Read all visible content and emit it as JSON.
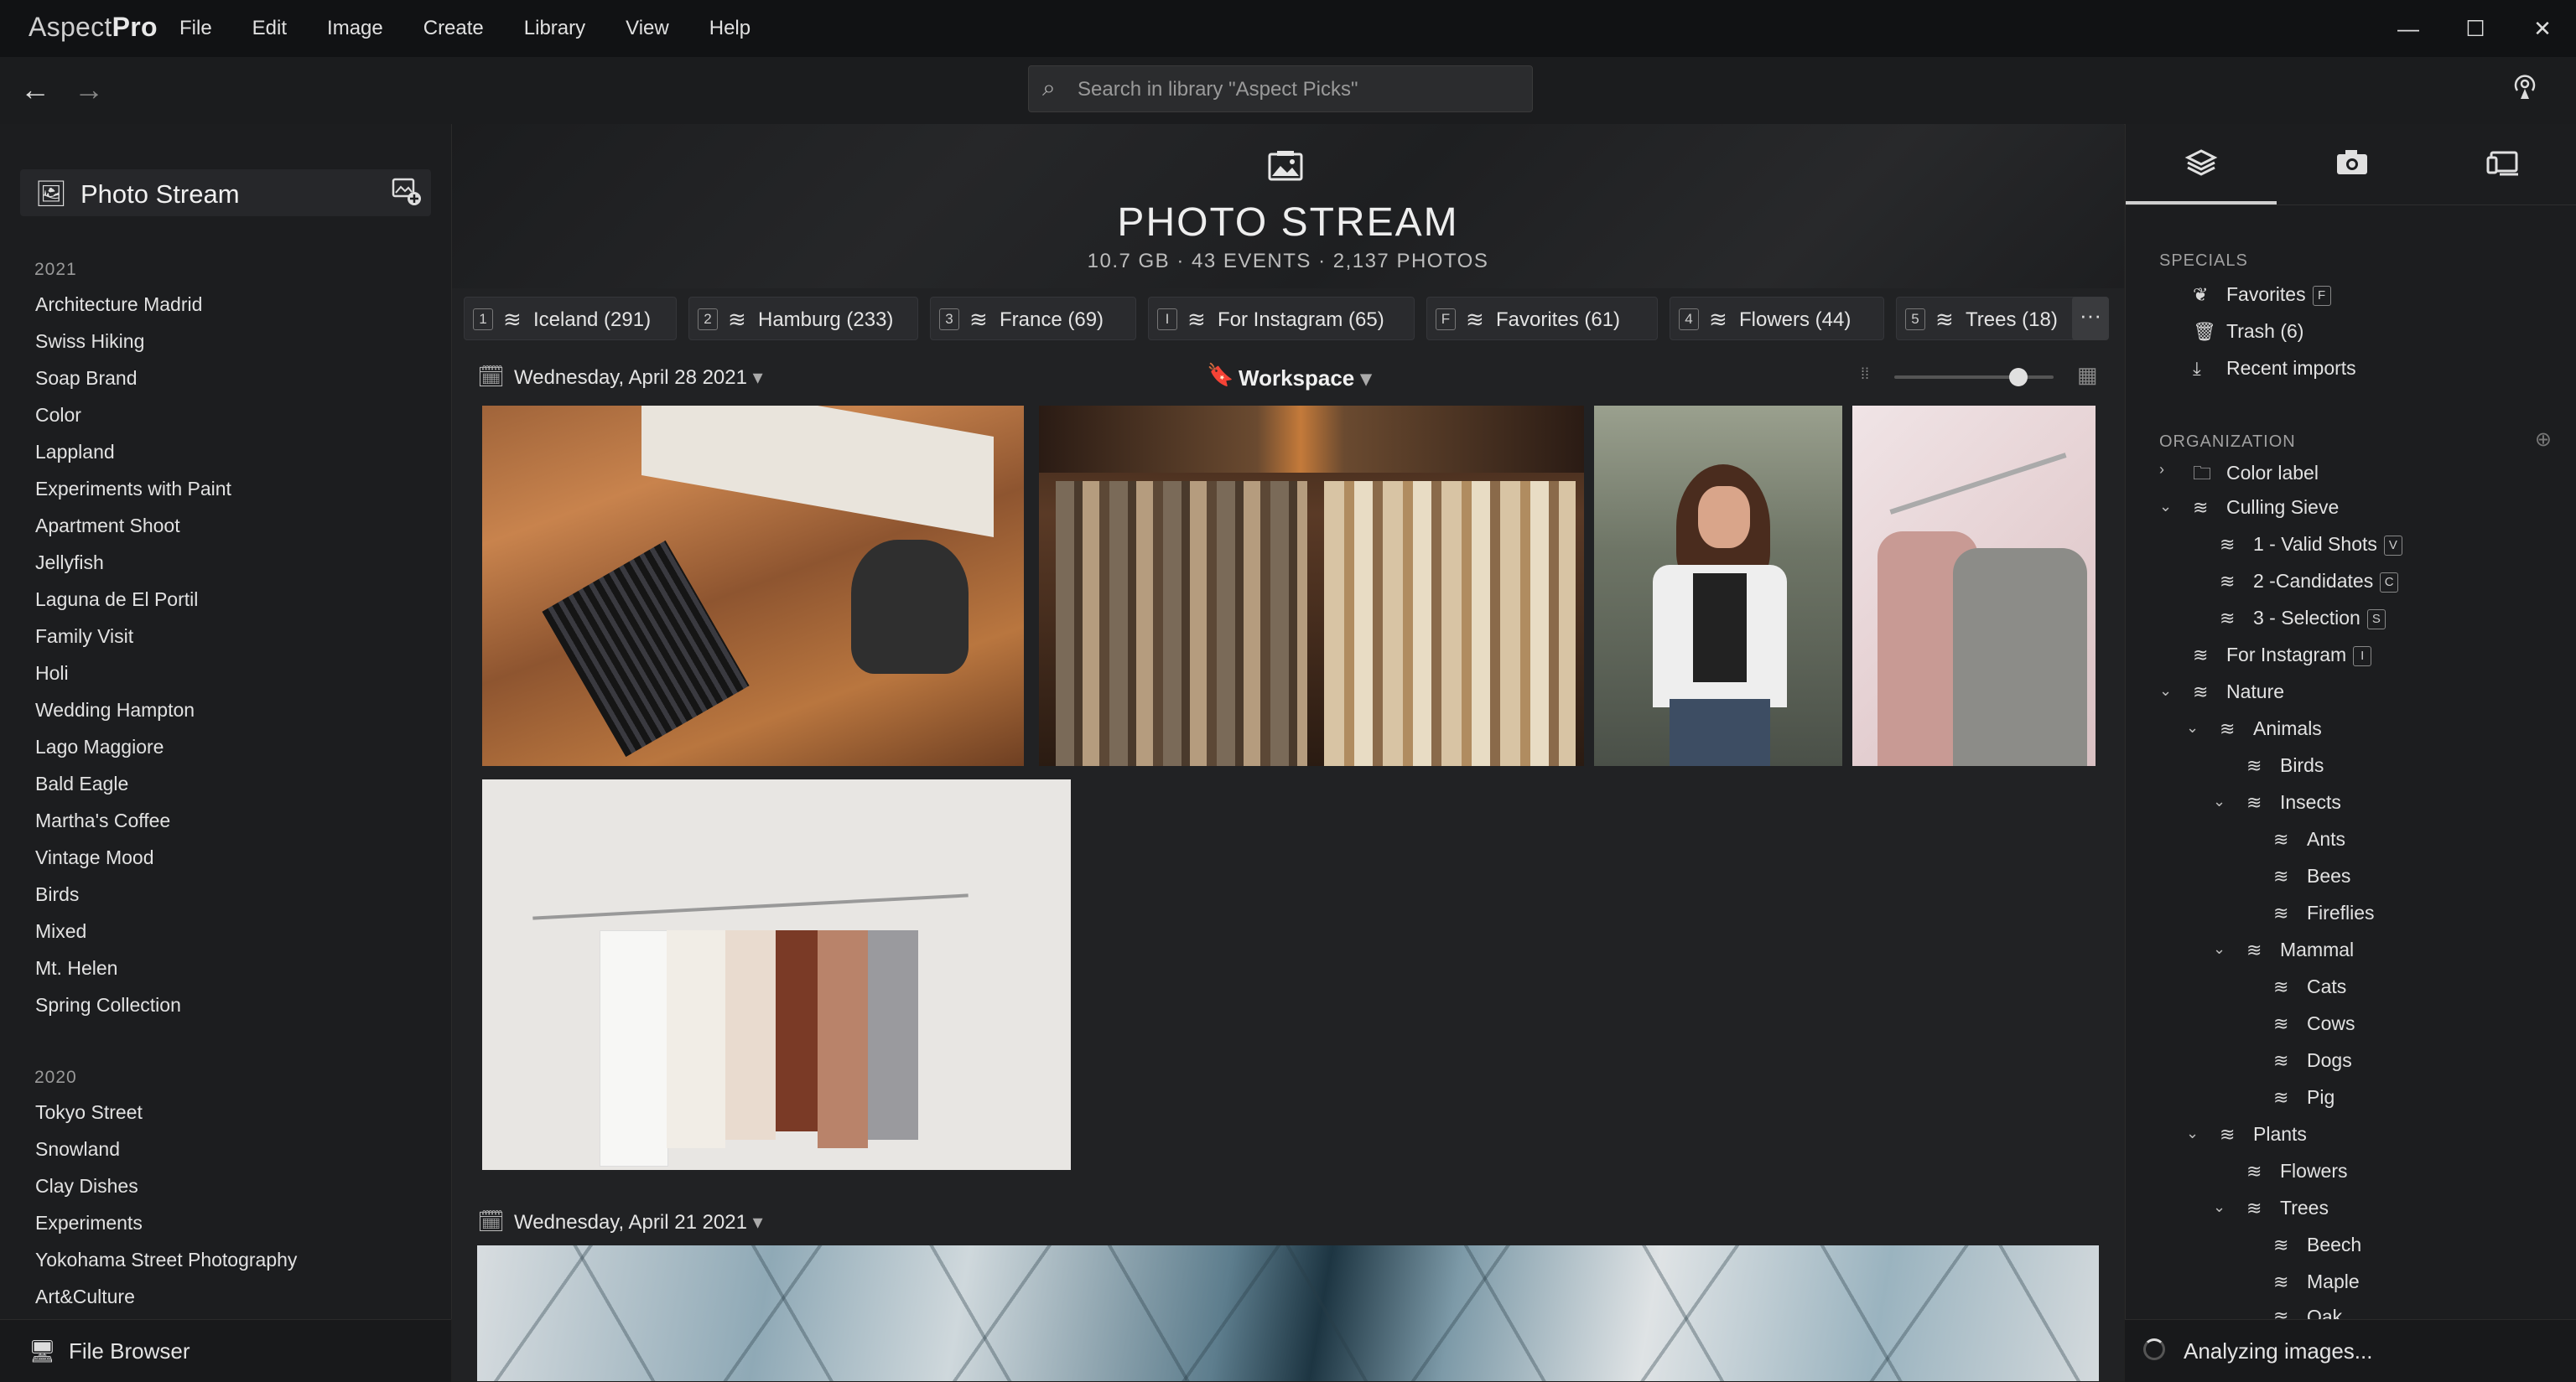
{
  "app": {
    "brand_light": "Aspect",
    "brand_bold": "Pro",
    "menu": [
      "File",
      "Edit",
      "Image",
      "Create",
      "Library",
      "View",
      "Help"
    ],
    "window_controls": [
      "—",
      "☐",
      "✕"
    ]
  },
  "toolbar": {
    "back": "←",
    "forward": "→",
    "search_placeholder": "Search in library \"Aspect Picks\"",
    "search_icon": "search-icon"
  },
  "sidebar": {
    "header_label": "Photo Stream",
    "groups": [
      {
        "year": "2021",
        "items": [
          "Architecture Madrid",
          "Swiss Hiking",
          "Soap Brand",
          "Color",
          "Lappland",
          "Experiments with Paint",
          "Apartment Shoot",
          "Jellyfish",
          "Laguna de El Portil",
          "Family Visit",
          "Holi",
          "Wedding Hampton",
          "Lago Maggiore",
          "Bald Eagle",
          "Martha's Coffee",
          "Vintage Mood",
          "Birds",
          "Mixed",
          "Mt. Helen",
          "Spring Collection"
        ]
      },
      {
        "year": "2020",
        "items": [
          "Tokyo Street",
          "Snowland",
          "Clay Dishes",
          "Experiments",
          "Yokohama Street Photography",
          "Art&Culture"
        ]
      }
    ],
    "footer_label": "File Browser"
  },
  "hero": {
    "title": "PHOTO STREAM",
    "subtitle": "10.7 GB  ·  43 EVENTS  ·  2,137 PHOTOS"
  },
  "chips": [
    {
      "key": "1",
      "label": "Iceland (291)"
    },
    {
      "key": "2",
      "label": "Hamburg (233)"
    },
    {
      "key": "3",
      "label": "France (69)"
    },
    {
      "key": "I",
      "label": "For Instagram (65)"
    },
    {
      "key": "F",
      "label": "Favorites (61)"
    },
    {
      "key": "4",
      "label": "Flowers (44)"
    },
    {
      "key": "5",
      "label": "Trees (18)"
    }
  ],
  "chips_more": "···",
  "events": [
    {
      "date": "Wednesday, April 28 2021",
      "caret": "▾"
    },
    {
      "date": "Wednesday, April 21 2021",
      "caret": "▾"
    }
  ],
  "workspace": {
    "label": "Workspace",
    "caret": "▾"
  },
  "zoom": {
    "value": 0.78
  },
  "right": {
    "specials_title": "SPECIALS",
    "specials": [
      {
        "label": "Favorites",
        "key": "F"
      },
      {
        "label": "Trash (6)",
        "key": ""
      },
      {
        "label": "Recent imports",
        "key": ""
      }
    ],
    "org_title": "ORGANIZATION",
    "org": [
      {
        "label": "Color label",
        "key": "",
        "caret": "›"
      },
      {
        "label": "Culling Sieve",
        "key": "",
        "caret": "⌄"
      },
      {
        "label": "1 - Valid Shots",
        "key": "V",
        "caret": ""
      },
      {
        "label": "2 -Candidates",
        "key": "C",
        "caret": ""
      },
      {
        "label": "3 - Selection",
        "key": "S",
        "caret": ""
      },
      {
        "label": "For Instagram",
        "key": "I",
        "caret": ""
      },
      {
        "label": "Nature",
        "key": "",
        "caret": "⌄"
      },
      {
        "label": "Animals",
        "key": "",
        "caret": "⌄"
      },
      {
        "label": "Birds",
        "key": "",
        "caret": ""
      },
      {
        "label": "Insects",
        "key": "",
        "caret": "⌄"
      },
      {
        "label": "Ants",
        "key": "",
        "caret": ""
      },
      {
        "label": "Bees",
        "key": "",
        "caret": ""
      },
      {
        "label": "Fireflies",
        "key": "",
        "caret": ""
      },
      {
        "label": "Mammal",
        "key": "",
        "caret": "⌄"
      },
      {
        "label": "Cats",
        "key": "",
        "caret": ""
      },
      {
        "label": "Cows",
        "key": "",
        "caret": ""
      },
      {
        "label": "Dogs",
        "key": "",
        "caret": ""
      },
      {
        "label": "Pig",
        "key": "",
        "caret": ""
      },
      {
        "label": "Plants",
        "key": "",
        "caret": "⌄"
      },
      {
        "label": "Flowers",
        "key": "",
        "caret": ""
      },
      {
        "label": "Trees",
        "key": "",
        "caret": "⌄"
      },
      {
        "label": "Beech",
        "key": "",
        "caret": ""
      },
      {
        "label": "Maple",
        "key": "",
        "caret": ""
      },
      {
        "label": "Oak",
        "key": "",
        "caret": ""
      }
    ],
    "footer_label": "Analyzing images..."
  }
}
